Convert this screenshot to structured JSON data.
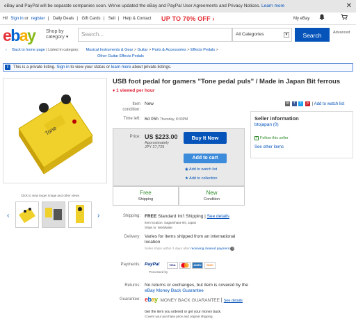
{
  "notice": {
    "text": "eBay and PayPal will be separate companies soon. We've updated the eBay and PayPal User Agreements and Privacy Notices.",
    "learn_more": "Learn more",
    "close": "✕"
  },
  "topbar": {
    "greeting": "Hi!",
    "signin": "Sign in",
    "or": "or",
    "register": "register",
    "items": [
      "Daily Deals",
      "Gift Cards",
      "Sell",
      "Help & Contact"
    ],
    "promo": "UP TO 70% OFF ›",
    "myebay": "My eBay"
  },
  "header": {
    "logo": [
      "e",
      "b",
      "a",
      "y"
    ],
    "shop_by": "Shop by category",
    "search_placeholder": "Search...",
    "category": "All Categories",
    "search_button": "Search",
    "advanced": "Advanced"
  },
  "breadcrumbs": {
    "back": "Back to home page",
    "listed_in": "Listed in category:",
    "cats": [
      "Musical Instruments & Gear",
      "Guitar",
      "Parts & Accessories",
      "Effects Pedals"
    ],
    "sub": "Other Guitar Effects Pedals"
  },
  "info": {
    "text1": "This is a private listing.",
    "signin": "Sign in",
    "text2": "to view your status or",
    "learn": "learn more",
    "text3": "about private listings."
  },
  "gallery": {
    "caption": "Click to view larger image and other views"
  },
  "listing": {
    "title": "USB foot pedal for gamers \"Tone pedal puls\" / Made in Japan Bit ferrous",
    "viewed": "1 viewed per hour",
    "condition_label": "Item condition:",
    "condition": "New",
    "time_label": "Time left:",
    "time": "6d 05h",
    "time_date": "Thursday, 8:30PM",
    "share_watch": "Add to watch list",
    "price_label": "Price:",
    "price": "US $223.00",
    "approx_label": "Approximately",
    "approx": "JPY 27,729",
    "buy_now": "Buy It Now",
    "add_cart": "Add to cart",
    "watch": "Add to watch list",
    "collection": "Add to collection",
    "free": "Free",
    "shipping": "Shipping",
    "new": "New",
    "condition2": "Condition"
  },
  "seller": {
    "heading": "Seller information",
    "name": "btojapan",
    "score": "(0)",
    "follow": "Follow this seller",
    "other": "See other items"
  },
  "details": {
    "shipping_label": "Shipping:",
    "shipping": "FREE",
    "shipping_method": "Standard Int'l Shipping",
    "see_details": "See details",
    "item_location": "Item location: Sagamihara-shi, Japan",
    "ships_to": "Ships to: Worldwide",
    "delivery_label": "Delivery:",
    "delivery": "Varies for items shipped from an international location",
    "seller_ships": "Seller ships within 3 days after",
    "receiving": "receiving cleared payment",
    "payments_label": "Payments:",
    "paypal": "PayPal",
    "processed": "Processed by",
    "cards": [
      "VISA",
      "MC",
      "AMEX",
      "DISC"
    ],
    "returns_label": "Returns:",
    "returns": "No returns or exchanges, but item is covered by the",
    "mbg_link": "eBay Money Back Guarantee",
    "guarantee_label": "Guarantee:",
    "mbg": "MONEY BACK GUARANTEE",
    "see": "See details",
    "mbg_desc": "Get the item you ordered or get your money back.",
    "mbg_desc2": "Covers your purchase price and original shipping."
  }
}
